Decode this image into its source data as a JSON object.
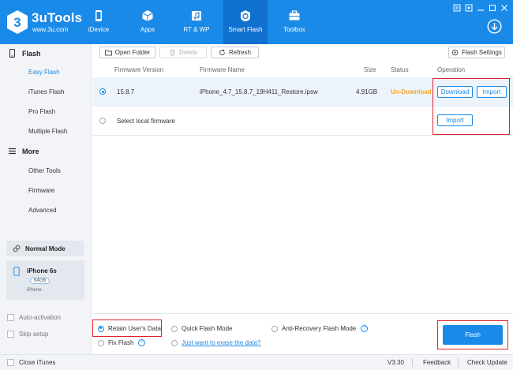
{
  "app": {
    "name": "3uTools",
    "url": "www.3u.com",
    "logo_mark": "3",
    "brand_color": "#1a8ae8"
  },
  "nav": [
    {
      "label": "iDevice",
      "icon": "phone-icon"
    },
    {
      "label": "Apps",
      "icon": "cube-icon"
    },
    {
      "label": "RT & WP",
      "icon": "music-icon"
    },
    {
      "label": "Smart Flash",
      "icon": "flash-icon",
      "active": true
    },
    {
      "label": "Toolbox",
      "icon": "toolbox-icon"
    }
  ],
  "sidebar": {
    "flash_header": "Flash",
    "flash_items": [
      "Easy Flash",
      "iTunes Flash",
      "Pro Flash",
      "Multiple Flash"
    ],
    "active_item": "Easy Flash",
    "more_header": "More",
    "more_items": [
      "Other Tools",
      "Firmware",
      "Advanced"
    ],
    "mode": "Normal Mode",
    "device": {
      "name": "iPhone 6s",
      "capacity": "64GB",
      "type": "iPhone"
    },
    "auto_activation": "Auto-activation",
    "skip_setup": "Skip setup"
  },
  "toolbar": {
    "open_folder": "Open Folder",
    "delete": "Delete",
    "refresh": "Refresh",
    "flash_settings": "Flash Settings"
  },
  "table": {
    "columns": {
      "version": "Firmware Version",
      "name": "Firmware Name",
      "size": "Size",
      "status": "Status",
      "operation": "Operation"
    },
    "row1": {
      "version": "15.8.7",
      "name": "iPhone_4.7_15.8.7_19H411_Restore.ipsw",
      "size": "4.91GB",
      "status": "Un-Download",
      "download": "Download",
      "import": "Import"
    },
    "row2": {
      "label": "Select local firmware",
      "import": "Import"
    }
  },
  "options": {
    "retain": "Retain User's Data",
    "quick": "Quick Flash Mode",
    "anti_recovery": "Anti-Recovery Flash Mode",
    "fix": "Fix Flash",
    "erase_link": "Just want to erase the data?",
    "help": "?",
    "flash": "Flash"
  },
  "statusbar": {
    "close_itunes": "Close iTunes",
    "version": "V3.30",
    "feedback": "Feedback",
    "check_update": "Check Update"
  }
}
